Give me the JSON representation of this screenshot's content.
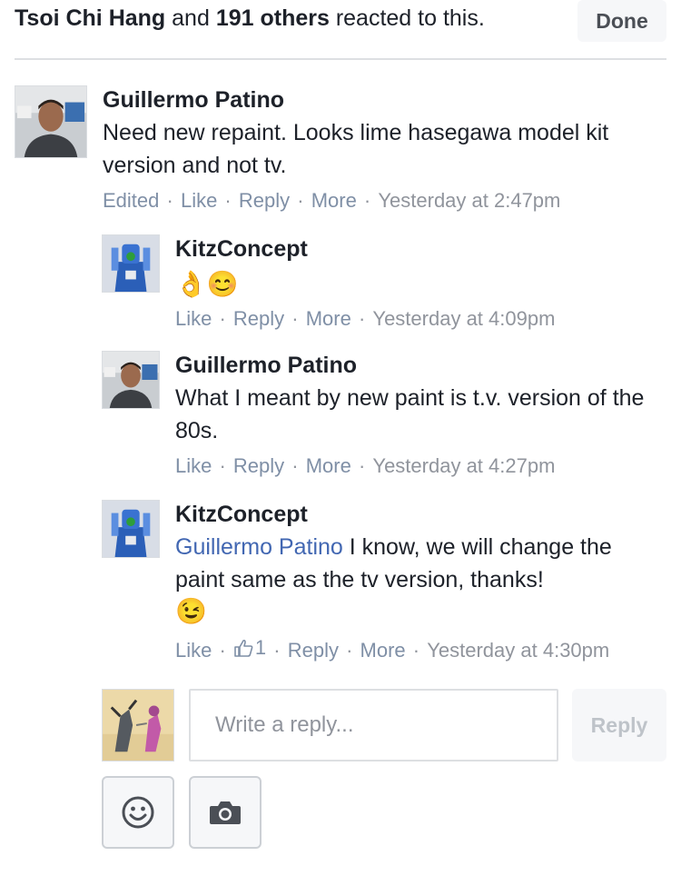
{
  "header": {
    "reactions_name": "Tsoi Chi Hang",
    "reactions_and": " and ",
    "reactions_others": "191 others",
    "reactions_tail": " reacted to this.",
    "done_label": "Done"
  },
  "comments": [
    {
      "author": "Guillermo Patino",
      "text": "Need new repaint. Looks lime hasegawa model kit version and not tv.",
      "meta": {
        "edited": "Edited",
        "like": "Like",
        "reply": "Reply",
        "more": "More",
        "time": "Yesterday at 2:47pm"
      }
    },
    {
      "author": "KitzConcept",
      "emojis": "👌😊",
      "meta": {
        "like": "Like",
        "reply": "Reply",
        "more": "More",
        "time": "Yesterday at 4:09pm"
      }
    },
    {
      "author": "Guillermo Patino",
      "text": "What I meant by new paint is t.v. version of the 80s.",
      "meta": {
        "like": "Like",
        "reply": "Reply",
        "more": "More",
        "time": "Yesterday at 4:27pm"
      }
    },
    {
      "author": "KitzConcept",
      "mention": "Guillermo Patino",
      "text": " I know, we will change the paint same as the tv version, thanks!",
      "emojis": "😉",
      "meta": {
        "like": "Like",
        "like_count": "1",
        "reply": "Reply",
        "more": "More",
        "time": "Yesterday at 4:30pm"
      }
    }
  ],
  "composer": {
    "placeholder": "Write a reply...",
    "reply_label": "Reply",
    "emoji_icon": "smiley-icon",
    "camera_icon": "camera-icon"
  },
  "colors": {
    "link": "#4267b2",
    "meta": "#90949c",
    "divider": "#dddfe2"
  }
}
